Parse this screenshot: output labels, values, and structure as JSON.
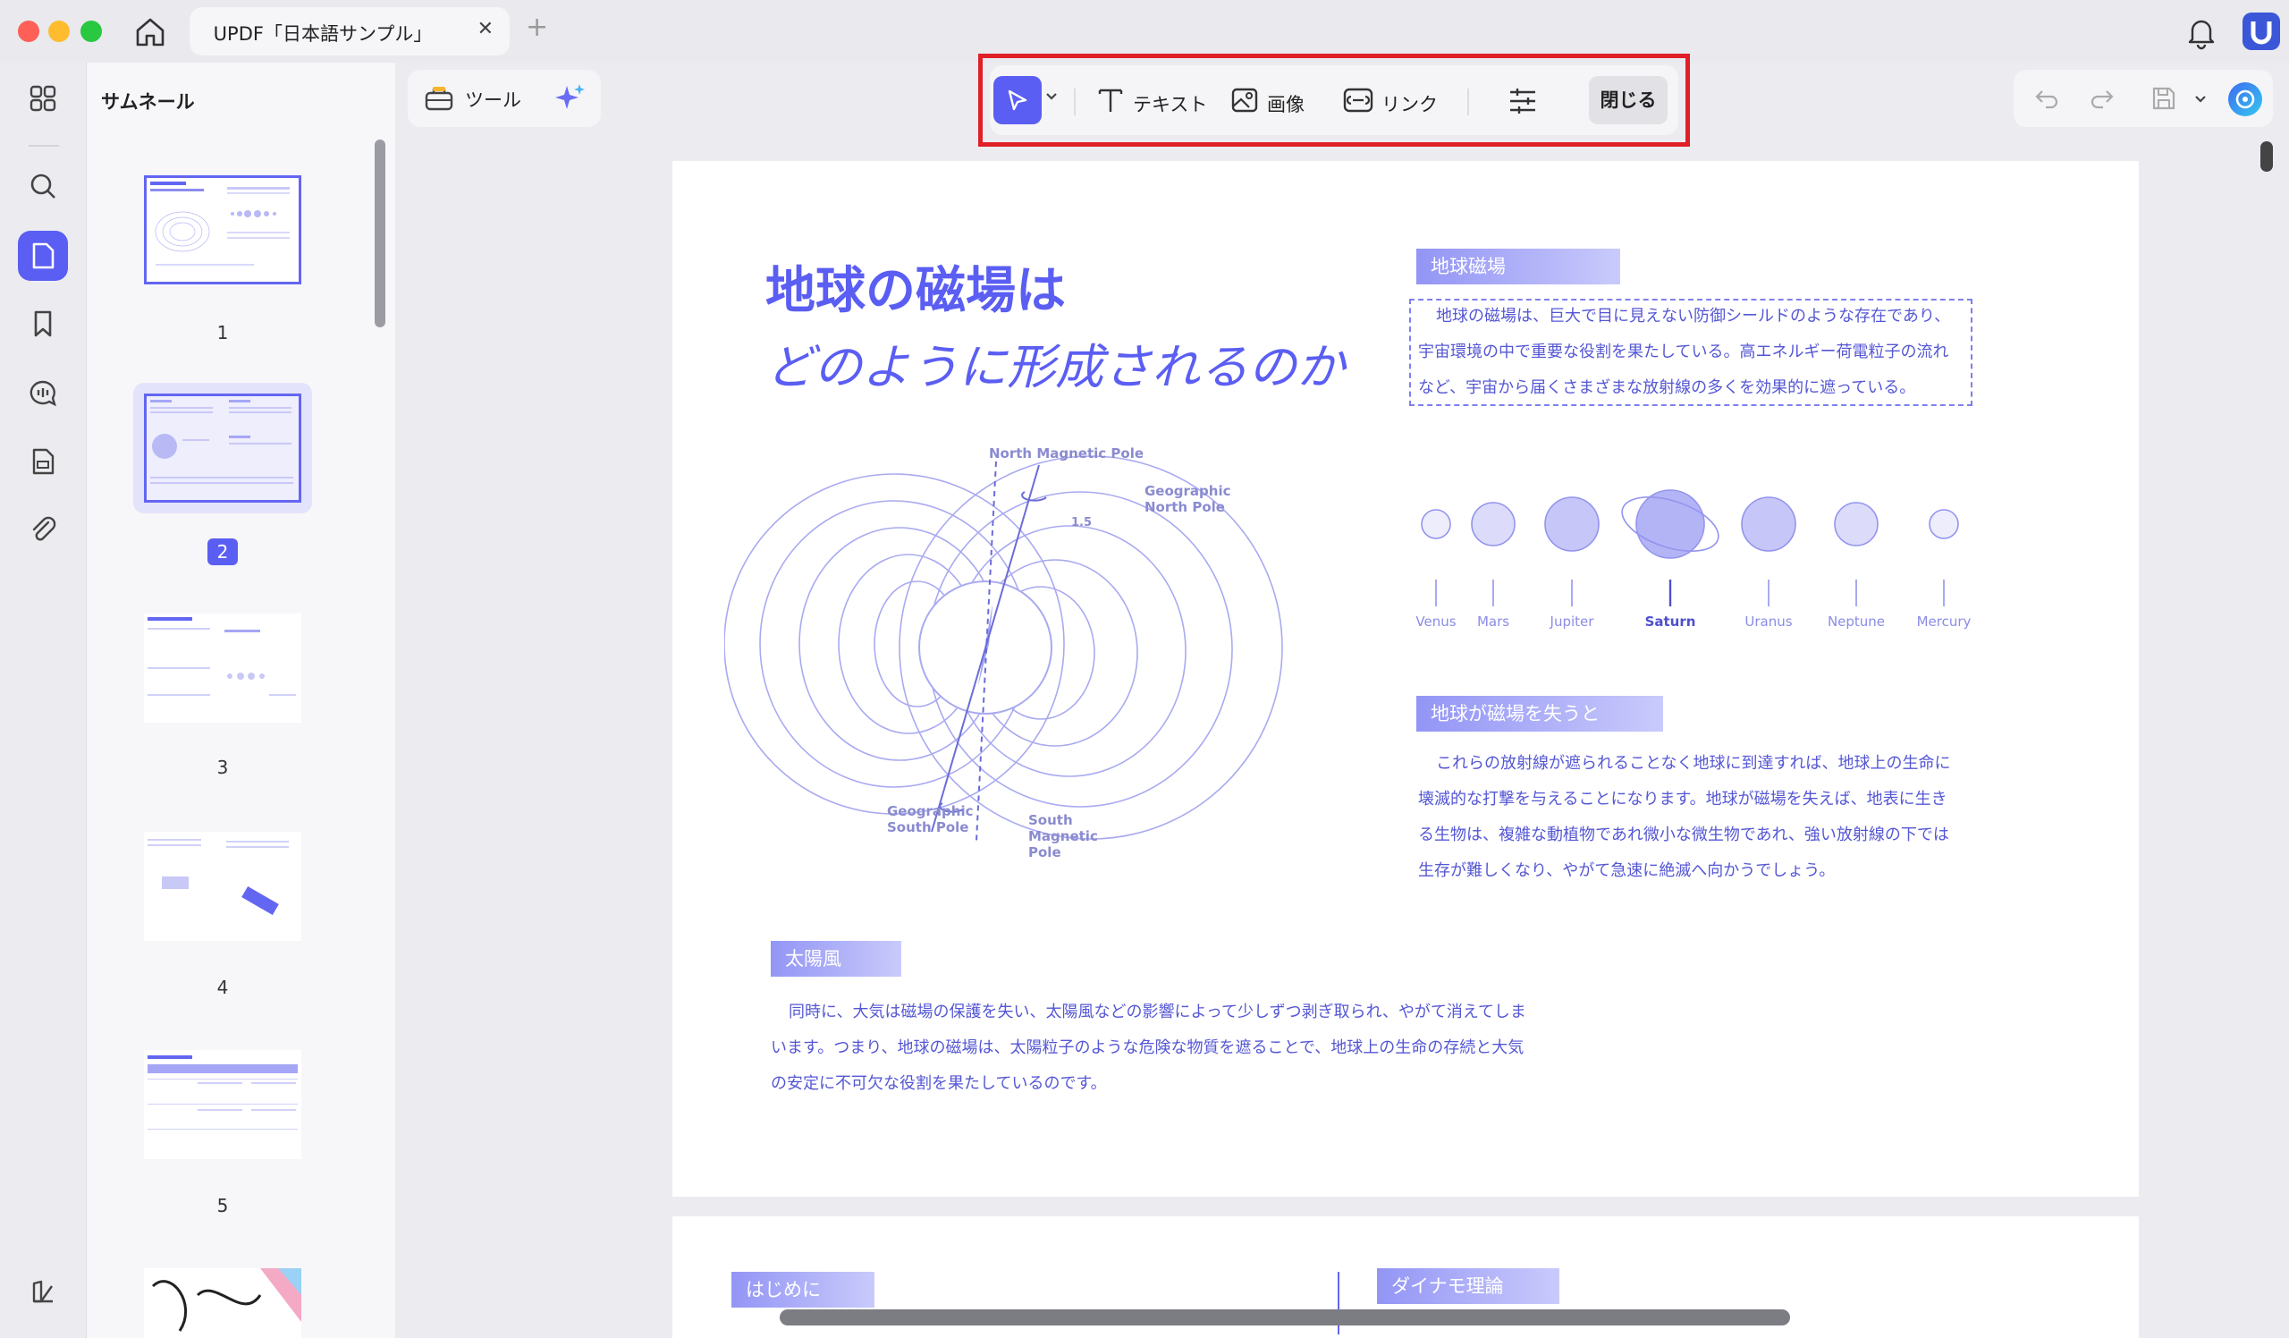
{
  "window": {
    "tab_title": "UPDF「日本語サンプル」"
  },
  "icons": {
    "home": "home-icon",
    "bell": "bell-icon",
    "close": "close-icon",
    "add": "plus-icon"
  },
  "sidebar": {
    "items": [
      "thumbnails-grid-icon",
      "search-icon",
      "pages-icon",
      "bookmark-icon",
      "comment-icon",
      "form-icon",
      "attachment-icon",
      "layers-icon"
    ]
  },
  "thumbnails": {
    "header": "サムネール",
    "pages": [
      "1",
      "2",
      "3",
      "4",
      "5"
    ],
    "selected": "2"
  },
  "toolbar": {
    "tools_label": "ツール",
    "text_label": "テキスト",
    "image_label": "画像",
    "link_label": "リンク",
    "close_label": "閉じる"
  },
  "colors": {
    "accent": "#5b5ef2",
    "highlight_box": "#e01f26"
  },
  "document": {
    "title_line1": "地球の磁場は",
    "title_line2": "どのように形成されるのか",
    "section1_label": "地球磁場",
    "section1_lines": [
      "地球の磁場は、巨大で目に見えない防御シールドのような存在であり、",
      "宇宙環境の中で重要な役割を果たしている。高エネルギー荷電粒子の流れ",
      "など、宇宙から届くさまざまな放射線の多くを効果的に遮っている。"
    ],
    "diagram": {
      "north_magnetic": "North Magnetic Pole",
      "geographic_north": "Geographic North Pole",
      "geographic_south": "Geographic South Pole",
      "south_magnetic": "South Magnetic Pole",
      "angle": "1.5"
    },
    "planets": [
      "Venus",
      "Mars",
      "Jupiter",
      "Saturn",
      "Uranus",
      "Neptune",
      "Mercury"
    ],
    "section2_label": "地球が磁場を失うと",
    "section2_lines": [
      "これらの放射線が遮られることなく地球に到達すれば、地球上の生命に",
      "壊滅的な打撃を与えることになります。地球が磁場を失えば、地表に生き",
      "る生物は、複雑な動植物であれ微小な微生物であれ、強い放射線の下では",
      "生存が難しくなり、やがて急速に絶滅へ向かうでしょう。"
    ],
    "section3_label": "太陽風",
    "section3_lines": [
      "同時に、大気は磁場の保護を失い、太陽風などの影響によって少しずつ剥ぎ取られ、やがて消えてしま",
      "います。つまり、地球の磁場は、太陽粒子のような危険な物質を遮ることで、地球上の生命の存続と大気",
      "の安定に不可欠な役割を果たしているのです。"
    ],
    "next_page_label1": "はじめに",
    "next_page_label2": "ダイナモ理論"
  }
}
